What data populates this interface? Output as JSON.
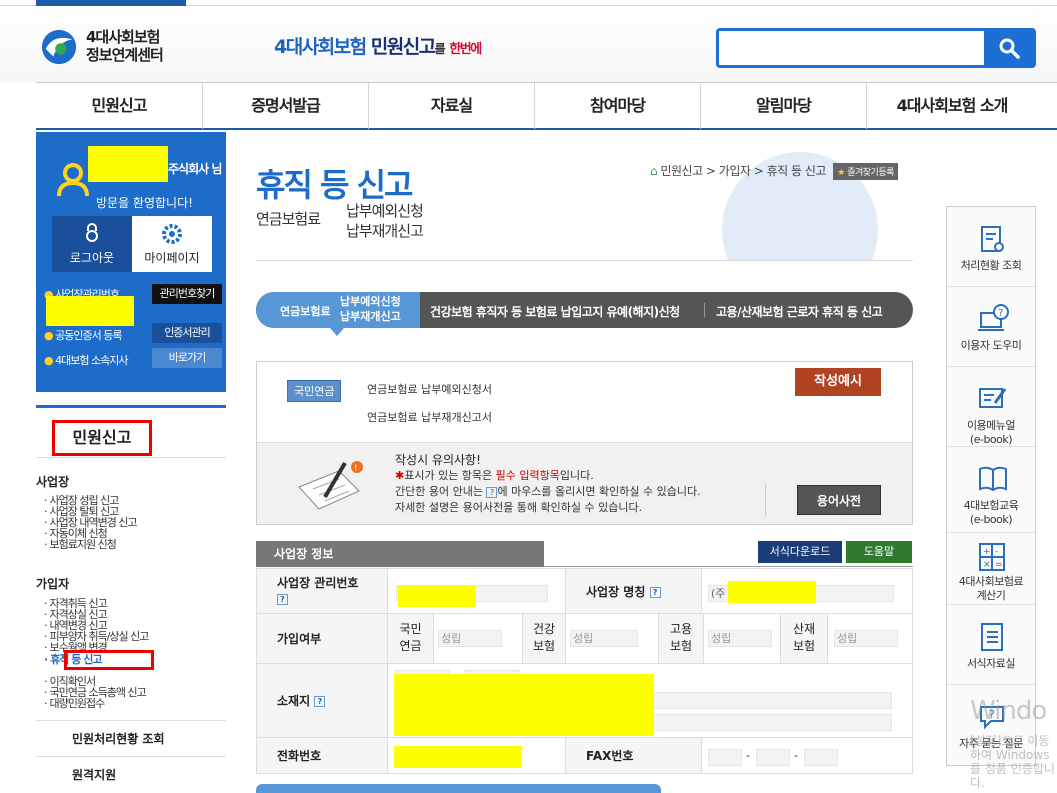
{
  "header": {
    "logo_line1": "4대사회보험",
    "logo_line2": "정보연계센터",
    "slogan_a": "4대사회보험",
    "slogan_b": "민원신고",
    "slogan_c": "를",
    "slogan_d": "한번에",
    "search_value": ""
  },
  "gnb": [
    "민원신고",
    "증명서발급",
    "자료실",
    "참여마당",
    "알림마당",
    "4대사회보험 소개"
  ],
  "login": {
    "company_suffix": "주식회사 님",
    "welcome": "방문을 환영합니다!",
    "logout": "로그아웃",
    "mypage": "마이페이지",
    "quick1": "사업장관리번호",
    "quick1_btn": "관리번호찾기",
    "quick2": "공동인증서 등록",
    "quick2_btn": "인증서관리",
    "quick3": "4대보험 소속지사",
    "quick3_btn": "바로가기"
  },
  "leftnav": {
    "section": "민원신고",
    "group1": "사업장",
    "group1_items": [
      "사업장 성립 신고",
      "사업장 탈퇴 신고",
      "사업장 내역변경 신고",
      "자동이체 신청",
      "보험료지원 신청"
    ],
    "group2": "가입자",
    "group2_items": [
      "자격취득 신고",
      "자격상실 신고",
      "내역변경 신고",
      "피부양자 취득/상실 신고",
      "보수월액 변경",
      "휴직 등 신고",
      "이직확인서",
      "국민연금 소득총액 신고",
      "대량민원접수"
    ],
    "link1": "민원처리현황 조회",
    "link2": "원격지원"
  },
  "content": {
    "title": "휴직 등 신고",
    "subtitle_small": "연금보험료",
    "subtitle_line1": "납부예외신청",
    "subtitle_line2": "납부재개신고",
    "breadcrumb": "민원신고 > 가입자 > 휴직 등 신고",
    "fav": "즐겨찾기등록",
    "tab_active_small": "연금보험료",
    "tab_active_l1": "납부예외신청",
    "tab_active_l2": "납부재개신고",
    "tab2": "건강보험 휴직자 등 보험료 납입고지 유예(해지)신청",
    "tab3": "고용/산재보험 근로자 휴직 등 신고",
    "badge": "국민연금",
    "doc1": "연금보험료 납부예외신청서",
    "doc2": "연금보험료 납부재개신고서",
    "sample_btn": "작성예시",
    "note_title": "작성시 유의사항!",
    "note1_a": "표시가 있는 항목은 ",
    "note1_b": "필수 입력항목",
    "note1_c": "입니다.",
    "note2_a": "간단한 용어 안내는 ",
    "note2_b": "에 마우스를 올리시면 확인하실 수 있습니다.",
    "note3": "자세한 설명은 용어사전을 통해 확인하실 수 있습니다.",
    "dict_btn": "용어사전",
    "section_head": "사업장 정보",
    "download_btn": "서식다운로드",
    "help_btn": "도움말",
    "row1_label": "사업장 관리번호",
    "row1_label2": "사업장 명칭",
    "company_prefix": "(주",
    "row2_label": "가입여부",
    "ins1": "국민\n연금",
    "ins2": "건강\n보험",
    "ins3": "고용\n보험",
    "ins4": "산재\n보험",
    "status": "성립",
    "row3_label": "소재지",
    "row4_label": "전화번호",
    "row4_label2": "FAX번호",
    "dash": "-"
  },
  "side": [
    "처리현황 조회",
    "이용자 도우미",
    "이용메뉴얼\n(e-book)",
    "4대보험교육\n(e-book)",
    "4대사회보험료\n계산기",
    "서식자료실",
    "자주 묻는 질문"
  ],
  "watermark": "Windo",
  "watermark2": "[설정]으로 이동하여 Windows를 정품 인증합니다.",
  "colors": {
    "brand": "#1e6cc9",
    "nav_underline": "#1d5aa8",
    "sample_btn": "#b04422",
    "redact": "#ffff00"
  }
}
